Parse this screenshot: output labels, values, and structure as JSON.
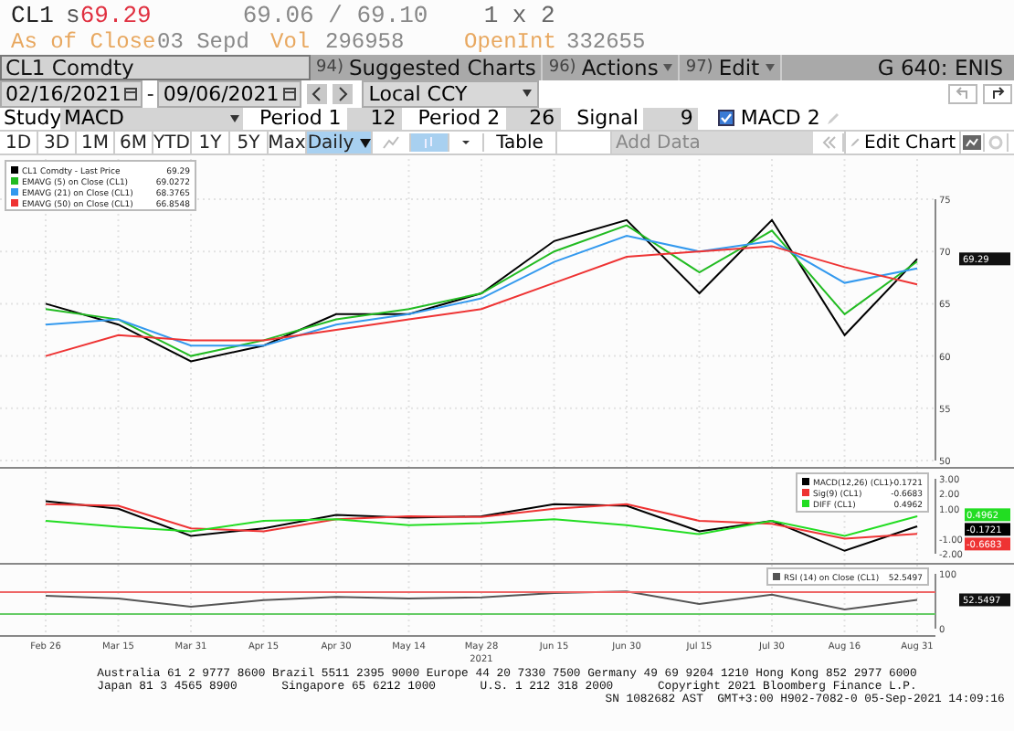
{
  "quote": {
    "ticker": "CL1",
    "flag": "s",
    "last": "69.29",
    "bid_ask": "69.06 / 69.10",
    "size": "1 x 2"
  },
  "close_info": {
    "label": "As of Close",
    "date": "03 Sepd",
    "vol_label": "Vol",
    "vol": "296958",
    "oi_label": "OpenInt",
    "oi": "332655"
  },
  "command_bar": {
    "security": "CL1 Comdty",
    "menus": [
      {
        "number": "94)",
        "label": "Suggested Charts",
        "dropdown": false
      },
      {
        "number": "96)",
        "label": "Actions",
        "dropdown": true
      },
      {
        "number": "97)",
        "label": "Edit",
        "dropdown": true
      }
    ],
    "function": "G 640: ENIS"
  },
  "range": {
    "start": "02/16/2021",
    "separator": "-",
    "end": "09/06/2021",
    "currency": "Local CCY"
  },
  "study": {
    "label": "Study",
    "value": "MACD",
    "params": [
      {
        "label": "Period 1",
        "value": "12"
      },
      {
        "label": "Period 2",
        "value": "26"
      },
      {
        "label": "Signal",
        "value": "9"
      }
    ],
    "macd2": {
      "label": "MACD 2",
      "checked": true
    }
  },
  "periods": [
    {
      "label": "1D",
      "selected": false
    },
    {
      "label": "3D",
      "selected": false
    },
    {
      "label": "1M",
      "selected": false
    },
    {
      "label": "6M",
      "selected": false
    },
    {
      "label": "YTD",
      "selected": false
    },
    {
      "label": "1Y",
      "selected": false
    },
    {
      "label": "5Y",
      "selected": false
    },
    {
      "label": "Max",
      "selected": false
    },
    {
      "label": "Daily",
      "selected": true
    }
  ],
  "toolbar": {
    "table": "Table",
    "add_data_placeholder": "Add Data",
    "edit_chart": "Edit Chart"
  },
  "price_panel": {
    "legend_values": [
      "69.29",
      "69.0272",
      "68.3765",
      "66.8548"
    ],
    "last_tag": "69.29",
    "chart_data": {
      "type": "line",
      "ylim": [
        50,
        75
      ],
      "yticks": [
        50,
        55,
        60,
        65,
        70,
        75
      ],
      "series": [
        {
          "name": "CL1 Comdty - Last Price",
          "color": "#000000",
          "values": [
            65,
            63,
            59.5,
            61,
            64,
            64,
            66,
            71,
            73,
            66,
            73,
            62,
            69.29
          ]
        },
        {
          "name": "EMAVG (5) on Close (CL1)",
          "color": "#22bb22",
          "values": [
            64.5,
            63.5,
            60,
            61.5,
            63.5,
            64.5,
            66,
            70,
            72.5,
            68,
            72,
            64,
            69.03
          ]
        },
        {
          "name": "EMAVG (21) on Close (CL1)",
          "color": "#3399ee",
          "values": [
            63,
            63.5,
            61,
            61,
            63,
            64,
            65.5,
            69,
            71.5,
            70,
            71,
            67,
            68.38
          ]
        },
        {
          "name": "EMAVG (50) on Close (CL1)",
          "color": "#ee3333",
          "values": [
            60,
            62,
            61.5,
            61.5,
            62.5,
            63.5,
            64.5,
            67,
            69.5,
            70,
            70.5,
            68.5,
            66.85
          ]
        }
      ]
    }
  },
  "macd_panel": {
    "legend_values": [
      "-0.1721",
      "-0.6683",
      "0.4962"
    ],
    "tags": [
      {
        "text": "0.4962",
        "color": "#22dd22"
      },
      {
        "text": "-0.1721",
        "color": "#000000"
      },
      {
        "text": "-0.6683",
        "color": "#ee3333"
      }
    ],
    "chart_data": {
      "type": "line",
      "ylim": [
        -2,
        3
      ],
      "yticks": [
        {
          "value": 3,
          "label": "3.00"
        },
        {
          "value": 2,
          "label": "2.00"
        },
        {
          "value": 1,
          "label": "1.00"
        },
        {
          "value": -1,
          "label": "-1.00"
        },
        {
          "value": -2,
          "label": "-2.00"
        }
      ],
      "series": [
        {
          "name": "MACD(12,26) (CL1)",
          "color": "#000000",
          "values": [
            1.5,
            1.0,
            -0.8,
            -0.3,
            0.6,
            0.4,
            0.5,
            1.3,
            1.2,
            -0.5,
            0.2,
            -1.8,
            -0.17
          ]
        },
        {
          "name": "Sig(9) (CL1)",
          "color": "#ee3333",
          "values": [
            1.3,
            1.2,
            -0.3,
            -0.5,
            0.3,
            0.5,
            0.45,
            1.0,
            1.3,
            0.2,
            0.0,
            -1.0,
            -0.67
          ]
        },
        {
          "name": "DIFF (CL1)",
          "color": "#22dd22",
          "values": [
            0.2,
            -0.2,
            -0.5,
            0.2,
            0.3,
            -0.1,
            0.05,
            0.3,
            -0.1,
            -0.7,
            0.2,
            -0.8,
            0.5
          ]
        }
      ]
    }
  },
  "rsi_panel": {
    "legend_values": [
      "52.5497"
    ],
    "tags": [
      "52.5497"
    ],
    "chart_data": {
      "type": "line",
      "ylim": [
        0,
        100
      ],
      "yticks": [
        0,
        100
      ],
      "categories": [
        "Feb 26",
        "Mar 15",
        "Mar 31",
        "Apr 15",
        "Apr 30",
        "May 14",
        "May 28",
        "Jun 15",
        "Jun 30",
        "Jul 15",
        "Jul 30",
        "Aug 16",
        "Aug 31"
      ],
      "series": [
        {
          "name": "RSI (14) on Close (CL1)",
          "color": "#555555",
          "values": [
            60,
            55,
            40,
            52,
            58,
            55,
            57,
            65,
            68,
            45,
            62,
            35,
            52.55
          ]
        }
      ]
    }
  },
  "x_axis_year": "2021",
  "footer": {
    "line1": "Australia 61 2 9777 8600 Brazil 5511 2395 9000 Europe 44 20 7330 7500 Germany 49 69 9204 1210 Hong Kong 852 2977 6000",
    "line2": [
      "Japan 81 3 4565 8900",
      "Singapore 65 6212 1000",
      "U.S. 1 212 318 2000",
      "Copyright 2021 Bloomberg Finance L.P."
    ],
    "line3": "SN 1082682 AST  GMT+3:00 H902-7082-0 05-Sep-2021 14:09:16"
  }
}
